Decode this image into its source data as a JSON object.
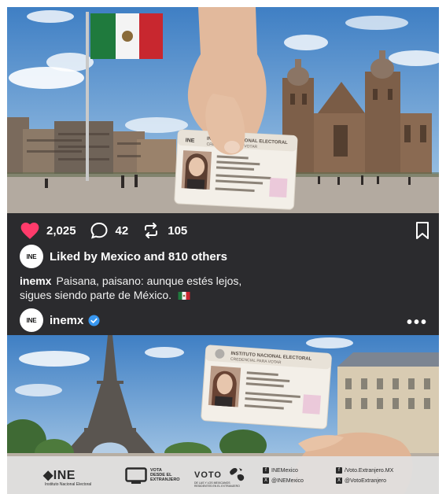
{
  "post": {
    "likes": "2,025",
    "comments": "42",
    "reposts": "105",
    "liked_by": "Liked by Mexico and 810 others",
    "username": "inemx",
    "caption_line1": "Paisana, paisano: aunque estés lejos,",
    "caption_line2": "sigues siendo parte de México.",
    "avatar_text": "INE",
    "liked_by_avatar_text": "INE",
    "more": "•••"
  },
  "colors": {
    "heart": "#ff3b6b",
    "verified": "#3897f0",
    "panel": "#2b2b2e"
  },
  "ine_card_top": {
    "header_line1": "INE",
    "header_line2": "INSTITUTO NACIONAL ELECTORAL",
    "header_line3": "CREDENCIAL PARA VOTAR"
  },
  "ine_card_bottom": {
    "header_line1": "INSTITUTO NACIONAL ELECTORAL",
    "header_line2": "CREDENCIAL PARA VOTAR"
  },
  "footer": {
    "ine_logo": "◆INE",
    "ine_sub": "Instituto Nacional Electoral",
    "vote_from_mx_1": "VOTA",
    "vote_from_mx_2": "DESDE EL",
    "vote_from_mx_3": "EXTRANJERO",
    "voto_logo": "VOTO",
    "voto_sub": "DE LAS Y LOS MEXICANOS RESIDENTES EN EL EXTRANJERO",
    "fb_ine": "INEMexico",
    "x_ine": "@INEMexico",
    "fb_voto": "/Voto.Extranjero.MX",
    "x_voto": "@VotoExtranjero"
  },
  "icons": [
    "heart-icon",
    "comment-icon",
    "repost-icon",
    "bookmark-icon",
    "verified-icon",
    "more-icon",
    "mexico-flag-icon",
    "facebook-icon",
    "x-icon"
  ]
}
